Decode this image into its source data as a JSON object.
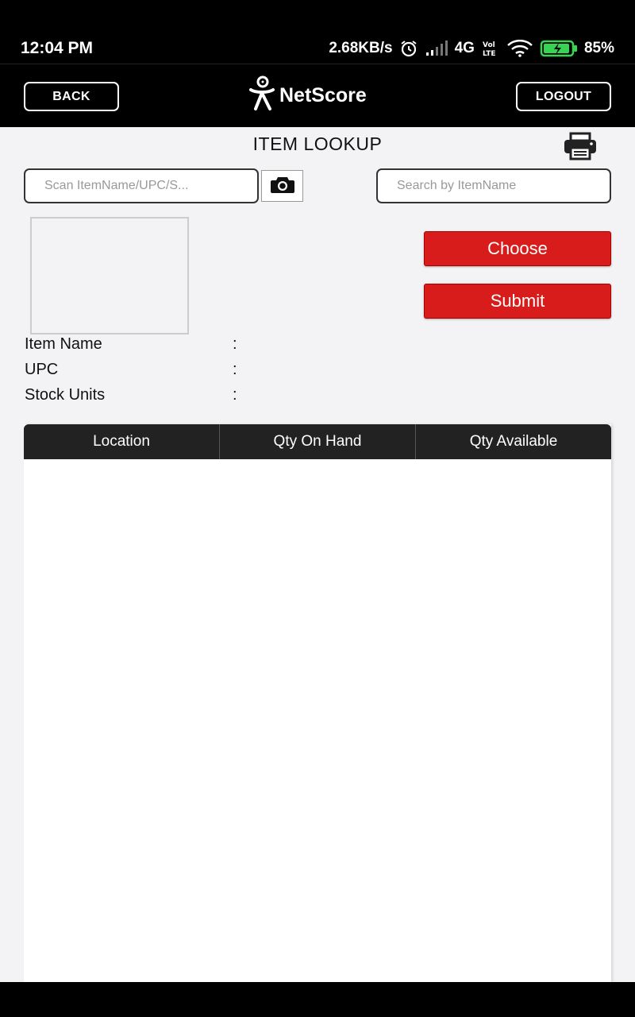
{
  "status_bar": {
    "time": "12:04 PM",
    "net_speed": "2.68KB/s",
    "network": "4G",
    "battery": "85%",
    "icons": [
      "alarm-icon",
      "signal-icon",
      "volte-icon",
      "wifi-icon",
      "battery-icon"
    ]
  },
  "header": {
    "back_label": "BACK",
    "logo_text": "NetScore",
    "logout_label": "LOGOUT"
  },
  "page": {
    "title": "ITEM LOOKUP"
  },
  "scan": {
    "placeholder": "Scan ItemName/UPC/S..."
  },
  "search": {
    "placeholder": "Search by ItemName"
  },
  "buttons": {
    "choose_label": "Choose",
    "submit_label": "Submit"
  },
  "details": {
    "item_name_label": "Item Name",
    "upc_label": "UPC",
    "stock_units_label": "Stock Units",
    "separator": ":"
  },
  "table": {
    "columns": [
      "Location",
      "Qty On Hand",
      "Qty Available"
    ],
    "rows": []
  },
  "colors": {
    "accent_red": "#d81b1b",
    "header_bg": "#000000",
    "table_header_bg": "#222222"
  }
}
